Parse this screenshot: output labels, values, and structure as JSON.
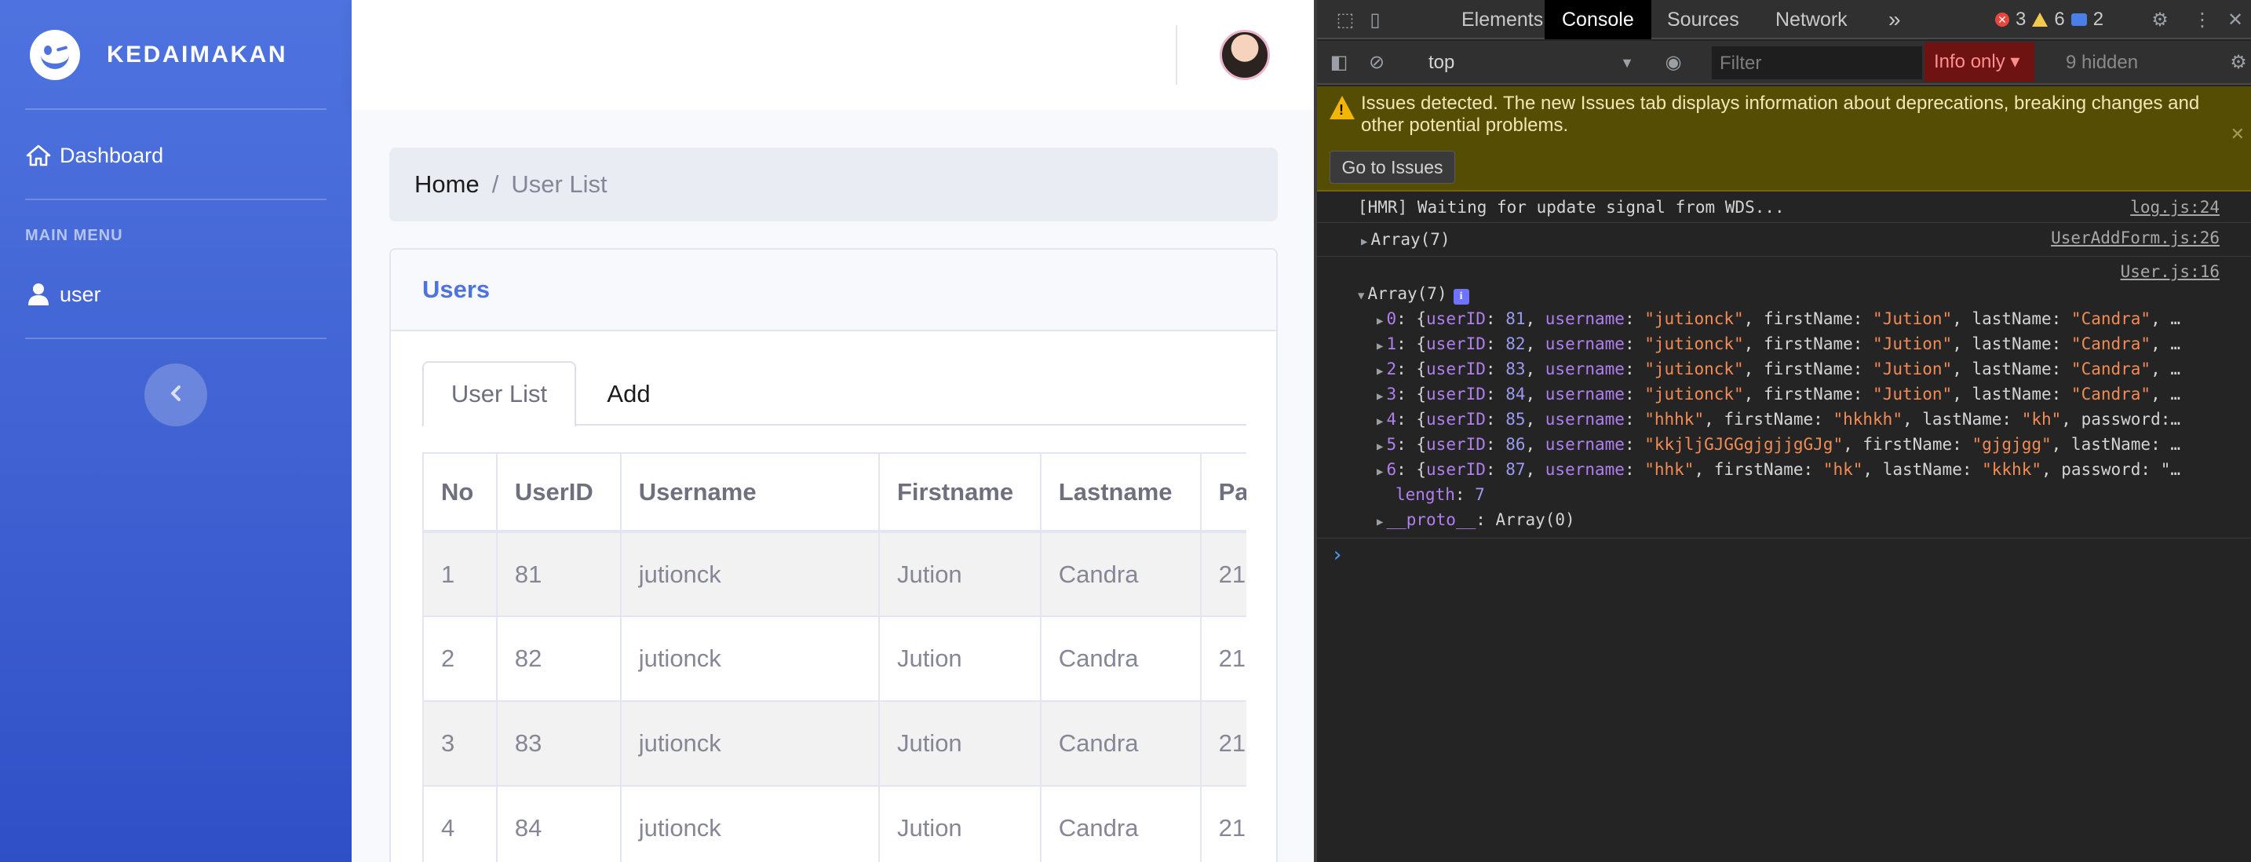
{
  "sidebar": {
    "brand": "KEDAIMAKAN",
    "dashboard_label": "Dashboard",
    "menu_heading": "MAIN MENU",
    "user_label": "user"
  },
  "breadcrumb": {
    "home": "Home",
    "separator": "/",
    "current": "User List"
  },
  "card": {
    "title": "Users",
    "tabs": [
      "User List",
      "Add"
    ],
    "table": {
      "headers": [
        "No",
        "UserID",
        "Username",
        "Firstname",
        "Lastname",
        "Pa"
      ],
      "rows": [
        [
          "1",
          "81",
          "jutionck",
          "Jution",
          "Candra",
          "21"
        ],
        [
          "2",
          "82",
          "jutionck",
          "Jution",
          "Candra",
          "21"
        ],
        [
          "3",
          "83",
          "jutionck",
          "Jution",
          "Candra",
          "21"
        ],
        [
          "4",
          "84",
          "jutionck",
          "Jution",
          "Candra",
          "21"
        ]
      ]
    }
  },
  "devtools": {
    "tabs": [
      "Elements",
      "Console",
      "Sources",
      "Network"
    ],
    "more_tabs": "»",
    "counts": {
      "errors": "3",
      "warnings": "6",
      "info": "2"
    },
    "context": "top",
    "filter_placeholder": "Filter",
    "level": "Info only ▾",
    "hidden": "9 hidden",
    "issues_text": "Issues detected. The new Issues tab displays information about deprecations, breaking changes and other potential problems.",
    "goto_issues": "Go to Issues",
    "logs": [
      {
        "msg": "[HMR] Waiting for update signal from WDS...",
        "src": "log.js:24"
      },
      {
        "msg": "Array(7)",
        "src": "UserAddForm.js:26"
      }
    ],
    "array_log": {
      "src": "User.js:16",
      "header": "Array(7)",
      "entries": [
        {
          "idx": "0",
          "userID": "81",
          "username": "\"jutionck\"",
          "tail": ", firstName: ",
          "fn": "\"Jution\"",
          "tail2": ", lastName: ",
          "ln": "\"Candra\"",
          "end": ", …"
        },
        {
          "idx": "1",
          "userID": "82",
          "username": "\"jutionck\"",
          "tail": ", firstName: ",
          "fn": "\"Jution\"",
          "tail2": ", lastName: ",
          "ln": "\"Candra\"",
          "end": ", …"
        },
        {
          "idx": "2",
          "userID": "83",
          "username": "\"jutionck\"",
          "tail": ", firstName: ",
          "fn": "\"Jution\"",
          "tail2": ", lastName: ",
          "ln": "\"Candra\"",
          "end": ", …"
        },
        {
          "idx": "3",
          "userID": "84",
          "username": "\"jutionck\"",
          "tail": ", firstName: ",
          "fn": "\"Jution\"",
          "tail2": ", lastName: ",
          "ln": "\"Candra\"",
          "end": ", …"
        },
        {
          "idx": "4",
          "userID": "85",
          "username": "\"hhhk\"",
          "tail": ", firstName: ",
          "fn": "\"hkhkh\"",
          "tail2": ", lastName: ",
          "ln": "\"kh\"",
          "end": ", password:…"
        },
        {
          "idx": "5",
          "userID": "86",
          "username": "\"kkjljGJGGgjgjjgGJg\"",
          "tail": ", firstName: ",
          "fn": "\"gjgjgg\"",
          "tail2": ", lastName: ",
          "ln": "",
          "end": "…"
        },
        {
          "idx": "6",
          "userID": "87",
          "username": "\"hhk\"",
          "tail": ", firstName: ",
          "fn": "\"hk\"",
          "tail2": ", lastName: ",
          "ln": "\"kkhk\"",
          "end": ", password: \"…"
        }
      ],
      "length_key": "length",
      "length_val": "7",
      "proto_key": "__proto__",
      "proto_val": "Array(0)"
    }
  }
}
